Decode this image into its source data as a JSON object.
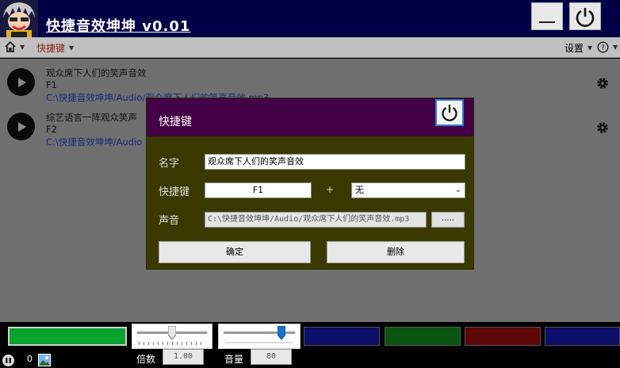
{
  "app": {
    "title": "快捷音效坤坤 v0.01"
  },
  "menu": {
    "shortcut_label": "快捷键",
    "settings_label": "设置"
  },
  "sounds": [
    {
      "title": "观众席下人们的笑声音效",
      "key": "F1",
      "path": "C:\\快捷音效坤坤/Audio/观众席下人们的笑声音效.mp3"
    },
    {
      "title": "综艺语言一阵观众笑声",
      "key": "F2",
      "path": "C:\\快捷音效坤坤/Audio"
    }
  ],
  "dialog": {
    "title": "快捷键",
    "name_label": "名字",
    "name_value": "观众席下人们的笑声音效",
    "shortcut_label": "快捷键",
    "key_value": "F1",
    "plus": "+",
    "modifier_value": "无",
    "sound_label": "声音",
    "sound_value": "C:\\快捷音效坤坤/Audio/观众席下人们的笑声音效.mp3",
    "browse_label": ".....",
    "ok_label": "确定",
    "delete_label": "删除"
  },
  "bottom": {
    "count": "0",
    "speed_label": "倍数",
    "speed_value": "1.00",
    "volume_label": "音量",
    "volume_value": "80",
    "speed_slider_fraction": 0.5,
    "volume_slider_fraction": 0.85,
    "colors": {
      "progress": "#0ca22e",
      "slot1": "#0e0e66",
      "slot2": "#0a5510",
      "slot3": "#5c0808",
      "slot4": "#0e0e66"
    }
  },
  "icons": [
    "logo-icon",
    "minimize-icon",
    "power-icon",
    "home-icon",
    "help-icon",
    "play-icon",
    "gear-icon",
    "pause-icon",
    "image-icon"
  ]
}
